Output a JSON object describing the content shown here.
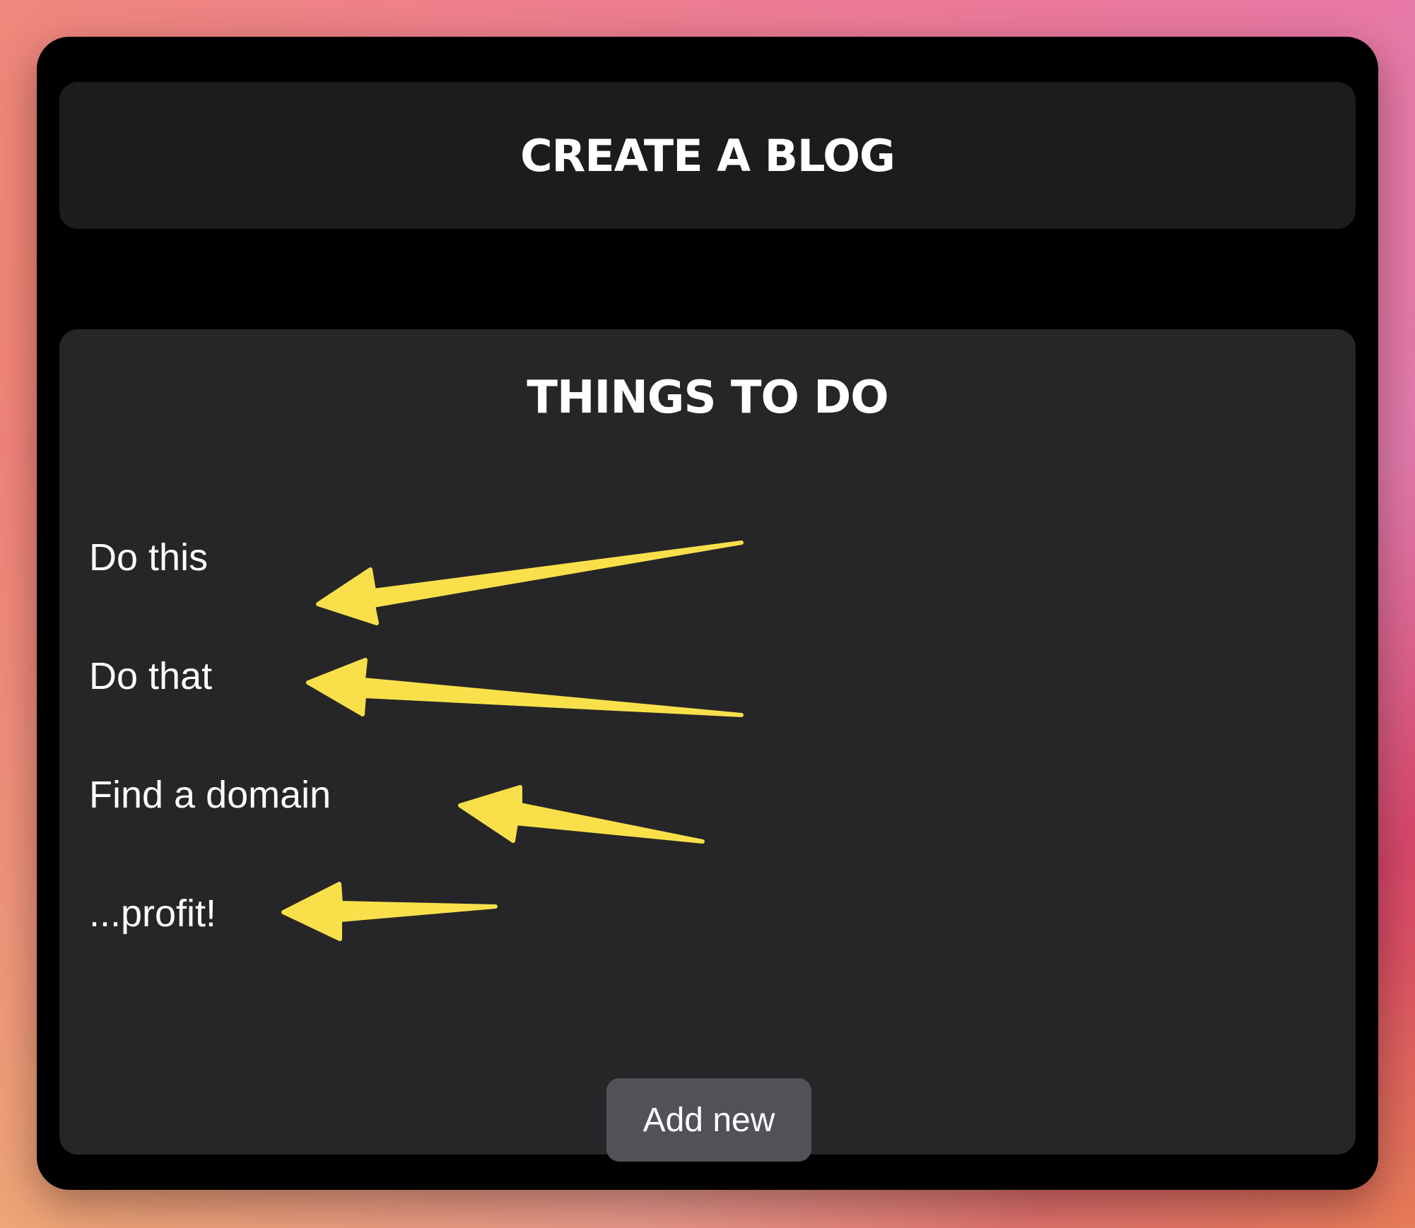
{
  "header": {
    "title": "CREATE A BLOG"
  },
  "todo": {
    "title": "THINGS TO DO",
    "items": [
      {
        "label": "Do this"
      },
      {
        "label": "Do that"
      },
      {
        "label": "Find a domain"
      },
      {
        "label": "...profit!"
      }
    ],
    "add_button_label": "Add new"
  },
  "annotations": {
    "arrow_color": "#f9e04b",
    "arrow_icon": "arrow-left-icon",
    "arrow_count": 4
  },
  "colors": {
    "window_bg": "#000000",
    "header_bg": "#1c1c1e",
    "card_bg": "#262628",
    "button_bg": "#515258",
    "text": "#ffffff"
  }
}
